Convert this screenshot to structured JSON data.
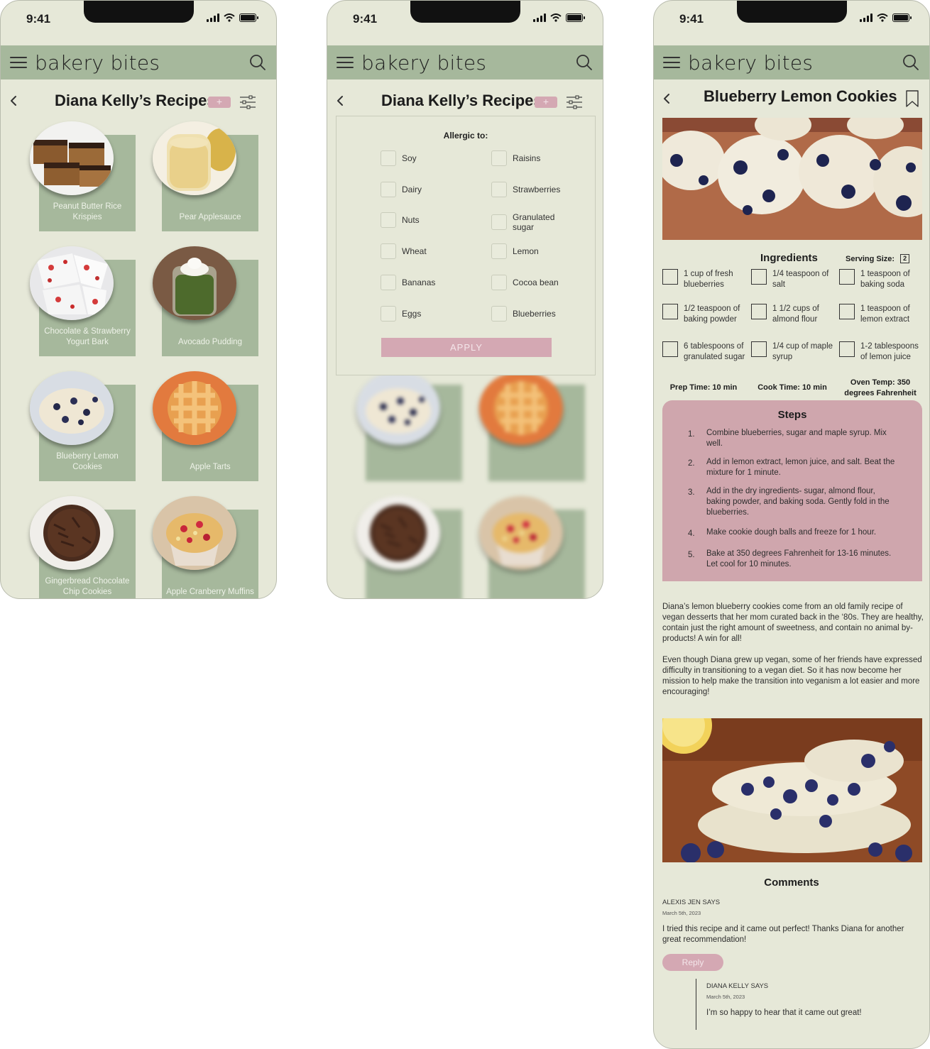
{
  "status": {
    "time": "9:41"
  },
  "app": {
    "brand": "bakery bites",
    "add_label": "+"
  },
  "list_screen": {
    "title": "Diana Kelly’s Recipes",
    "recipes": [
      {
        "name": "Peanut Butter Rice Krispies"
      },
      {
        "name": "Pear Applesauce"
      },
      {
        "name": "Chocolate & Strawberry Yogurt Bark"
      },
      {
        "name": "Avocado Pudding"
      },
      {
        "name": "Blueberry Lemon Cookies"
      },
      {
        "name": "Apple Tarts"
      },
      {
        "name": "Gingerbread Chocolate Chip Cookies"
      },
      {
        "name": "Apple Cranberry Muffins"
      }
    ]
  },
  "filter_screen": {
    "title": "Diana Kelly’s Recipes",
    "panel_title": "Allergic to:",
    "left_options": [
      "Soy",
      "Dairy",
      "Nuts",
      "Wheat",
      "Bananas",
      "Eggs"
    ],
    "right_options": [
      "Raisins",
      "Strawberries",
      "Granulated sugar",
      "Lemon",
      "Cocoa bean",
      "Blueberries"
    ],
    "apply_label": "APPLY"
  },
  "detail_screen": {
    "title": "Blueberry Lemon Cookies",
    "ingredients_title": "Ingredients",
    "serving_label": "Serving Size:",
    "serving_value": "2",
    "ingredients": [
      "1 cup of fresh blueberries",
      "1/4 teaspoon of salt",
      "1 teaspoon of baking soda",
      "1/2 teaspoon of baking powder",
      "1 1/2 cups of almond flour",
      "1 teaspoon of lemon extract",
      "6 tablespoons of granulated sugar",
      "1/4 cup of maple syrup",
      "1-2 tablespoons of lemon juice"
    ],
    "prep_time": "Prep Time: 10 min",
    "cook_time": "Cook Time: 10 min",
    "oven_temp": "Oven Temp: 350 degrees Fahrenheit",
    "steps_title": "Steps",
    "steps": [
      {
        "num": "1.",
        "text": "Combine blueberries, sugar and maple syrup. Mix well."
      },
      {
        "num": "2.",
        "text": "Add in lemon extract, lemon juice, and salt. Beat the mixture for 1 minute."
      },
      {
        "num": "3.",
        "text": "Add in the dry ingredients- sugar, almond flour, baking powder, and baking soda. Gently fold in the blueberries."
      },
      {
        "num": "4.",
        "text": "Make cookie dough balls and freeze for 1 hour."
      },
      {
        "num": "5.",
        "text": "Bake at 350 degrees Fahrenheit for 13-16 minutes. Let cool for 10 minutes."
      }
    ],
    "paragraph1": "Diana’s lemon blueberry cookies come from an old family recipe of vegan desserts that her mom curated back in the ‘80s. They are healthy, contain just the right amount of sweetness, and contain no animal by-products! A win for all!",
    "paragraph2": "Even though Diana grew up vegan, some of her friends have expressed difficulty in transitioning to a vegan diet. So it has now become her mission to help make the transition into veganism a lot easier and more encouraging!",
    "comments_title": "Comments",
    "comment": {
      "author": "ALEXIS JEN SAYS",
      "date": "March 5th, 2023",
      "text": "I tried this recipe and it came out perfect! Thanks Diana for another great recommendation!",
      "reply_label": "Reply"
    },
    "reply": {
      "author": "DIANA KELLY SAYS",
      "date": "March 5th, 2023",
      "text": "I’m so happy to hear that it came out great!"
    }
  },
  "colors": {
    "background": "#e6e8d8",
    "appbar": "#a6b89c",
    "accent_pink": "#d4a8b3",
    "steps_pink": "#cfa6ad"
  }
}
